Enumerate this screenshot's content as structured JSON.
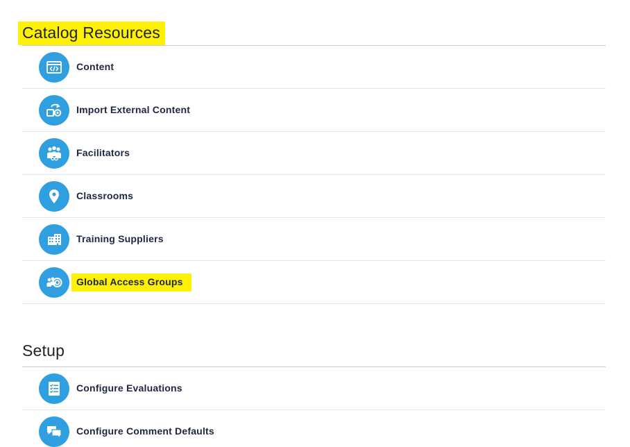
{
  "sections": [
    {
      "title": "Catalog Resources",
      "items": [
        {
          "label": "Content",
          "icon": "code-window-icon"
        },
        {
          "label": "Import External Content",
          "icon": "import-content-icon"
        },
        {
          "label": "Facilitators",
          "icon": "facilitators-icon"
        },
        {
          "label": "Classrooms",
          "icon": "location-pin-icon"
        },
        {
          "label": "Training Suppliers",
          "icon": "building-icon"
        },
        {
          "label": "Global Access Groups",
          "icon": "access-groups-icon"
        }
      ]
    },
    {
      "title": "Setup",
      "items": [
        {
          "label": "Configure Evaluations",
          "icon": "checklist-icon"
        },
        {
          "label": "Configure Comment Defaults",
          "icon": "comments-icon"
        }
      ]
    }
  ],
  "colors": {
    "icon_bg": "#2f9fe0",
    "highlight": "#fff200",
    "label_text": "#1e2540"
  }
}
